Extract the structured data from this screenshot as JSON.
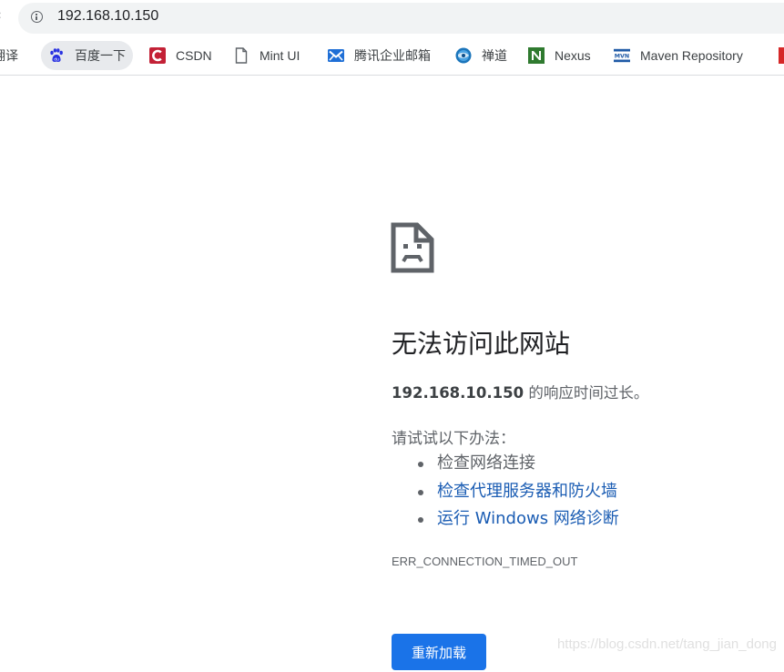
{
  "browser": {
    "back_partial": "‹",
    "url": "192.168.10.150",
    "bookmarks": [
      {
        "label": "翻译",
        "icon": "translate-icon"
      },
      {
        "label": "百度一下",
        "icon": "baidu-paw-icon"
      },
      {
        "label": "CSDN",
        "icon": "csdn-icon"
      },
      {
        "label": "Mint UI",
        "icon": "page-icon"
      },
      {
        "label": "腾讯企业邮箱",
        "icon": "tencent-mail-icon"
      },
      {
        "label": "禅道",
        "icon": "zentao-icon"
      },
      {
        "label": "Nexus",
        "icon": "nexus-icon"
      },
      {
        "label": "Maven Repository",
        "icon": "mvn-icon"
      },
      {
        "label": "",
        "icon": "partial-red-icon"
      }
    ]
  },
  "error_page": {
    "title": "无法访问此网站",
    "host": "192.168.10.150",
    "message_suffix": " 的响应时间过长。",
    "try_label": "请试试以下办法：",
    "suggestions": [
      {
        "text": "检查网络连接",
        "is_link": false
      },
      {
        "text": "检查代理服务器和防火墙",
        "is_link": true
      },
      {
        "text": "运行 Windows 网络诊断",
        "is_link": true
      }
    ],
    "error_code": "ERR_CONNECTION_TIMED_OUT",
    "reload_label": "重新加载"
  },
  "watermark": "https://blog.csdn.net/tang_jian_dong",
  "colors": {
    "link": "#1a5cb3",
    "button": "#1a73e8",
    "text_secondary": "#5f6368",
    "csdn_red": "#c32136"
  }
}
